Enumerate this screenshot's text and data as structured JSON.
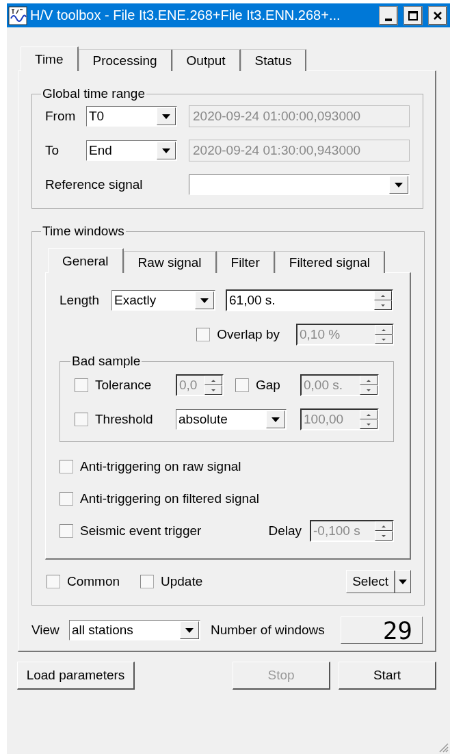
{
  "window": {
    "title": "H/V toolbox - File It3.ENE.268+File It3.ENN.268+..."
  },
  "tabs": [
    {
      "label": "Time",
      "selected": true
    },
    {
      "label": "Processing",
      "selected": false
    },
    {
      "label": "Output",
      "selected": false
    },
    {
      "label": "Status",
      "selected": false
    }
  ],
  "global_time_range": {
    "title": "Global time range",
    "from": {
      "label": "From",
      "mode": "T0",
      "value": "2020-09-24 01:00:00,093000",
      "disabled": true
    },
    "to": {
      "label": "To",
      "mode": "End",
      "value": "2020-09-24 01:30:00,943000",
      "disabled": true
    },
    "reference_signal": {
      "label": "Reference signal"
    }
  },
  "time_windows": {
    "title": "Time windows",
    "tabs": [
      {
        "label": "General",
        "selected": true
      },
      {
        "label": "Raw signal",
        "selected": false
      },
      {
        "label": "Filter",
        "selected": false
      },
      {
        "label": "Filtered signal",
        "selected": false
      }
    ],
    "length": {
      "label": "Length",
      "mode": "Exactly",
      "value": "61,00 s.",
      "disabled": false
    },
    "overlap": {
      "label": "Overlap by",
      "checked": false,
      "value": "0,10 %",
      "disabled": true
    },
    "bad_sample": {
      "title": "Bad sample",
      "tolerance": {
        "label": "Tolerance",
        "checked": false,
        "value": "0,0",
        "disabled": true
      },
      "gap": {
        "label": "Gap",
        "checked": false,
        "value": "0,00 s.",
        "disabled": true
      },
      "threshold": {
        "label": "Threshold",
        "checked": false,
        "mode": "absolute",
        "value": "100,00",
        "disabled": true
      }
    },
    "options": [
      {
        "label": "Anti-triggering on raw signal",
        "checked": false
      },
      {
        "label": "Anti-triggering on filtered signal",
        "checked": false
      },
      {
        "label": "Seismic event trigger",
        "checked": false
      }
    ],
    "delay": {
      "label": "Delay",
      "value": "-0,100 s",
      "disabled": true
    },
    "common": {
      "label": "Common",
      "checked": false
    },
    "update": {
      "label": "Update",
      "checked": false
    },
    "select_button": {
      "label": "Select"
    }
  },
  "view": {
    "label": "View",
    "value": "all stations"
  },
  "number_of_windows": {
    "label": "Number of windows",
    "value": "29"
  },
  "buttons": [
    {
      "label": "Load parameters",
      "disabled": false
    },
    {
      "label": "Stop",
      "disabled": true
    },
    {
      "label": "Start",
      "disabled": false
    }
  ]
}
